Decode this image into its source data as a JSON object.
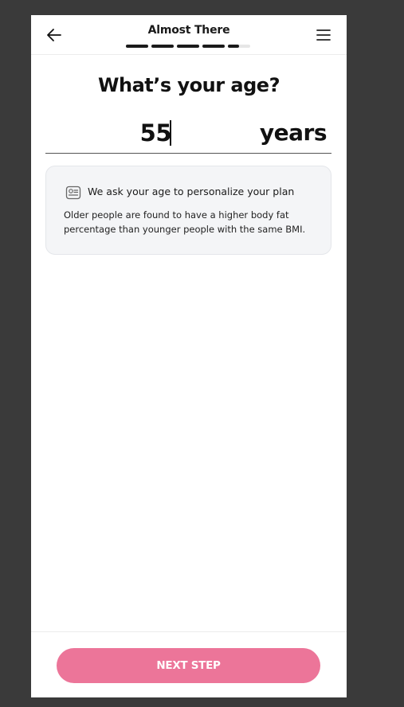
{
  "header": {
    "title": "Almost There",
    "back_icon": "arrow-left-icon",
    "menu_icon": "hamburger-menu-icon",
    "progress": {
      "total_steps": 5,
      "completed_steps": 4.5,
      "active_color": "#1a1a1a",
      "inactive_color": "#e6e6e6"
    }
  },
  "question": {
    "title": "What’s your age?"
  },
  "age_input": {
    "value": "55",
    "unit": "years"
  },
  "info": {
    "icon": "id-card-icon",
    "title": "We ask your age to personalize your plan",
    "body": "Older people are found to have a higher body fat percentage than younger people with the same BMI."
  },
  "footer": {
    "next_label": "NEXT STEP",
    "button_color": "#ec7599"
  }
}
